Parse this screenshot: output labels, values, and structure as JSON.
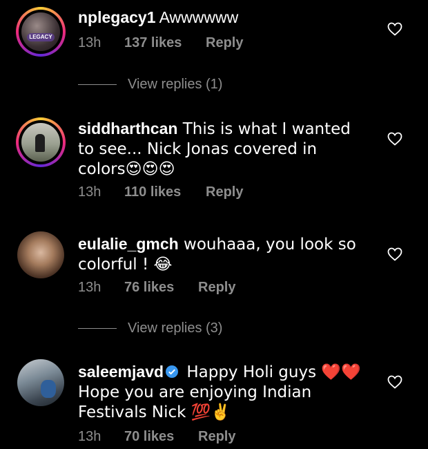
{
  "comments": [
    {
      "username": "nplegacy1",
      "text": " Awwwwww",
      "time": "13h",
      "likes": "137 likes",
      "reply": "Reply",
      "view_replies": "View replies (1)",
      "avatar_badge": "LEGACY"
    },
    {
      "username": "siddharthcan",
      "text": " This is what I wanted to see... Nick Jonas covered in colors😍😍😍",
      "time": "13h",
      "likes": "110 likes",
      "reply": "Reply"
    },
    {
      "username": "eulalie_gmch",
      "text": " wouhaaa, you look so colorful ! 😂",
      "time": "13h",
      "likes": "76 likes",
      "reply": "Reply",
      "view_replies": "View replies (3)"
    },
    {
      "username": "saleemjavd",
      "text": " Happy Holi guys ❤️❤️ Hope you are enjoying Indian Festivals Nick 💯✌️",
      "time": "13h",
      "likes": "70 likes",
      "reply": "Reply"
    }
  ],
  "icons": {
    "like": "heart-outline-icon",
    "verified": "verified-badge-icon"
  },
  "colors": {
    "background": "#000000",
    "text": "#ffffff",
    "muted": "#8e8e8e",
    "verified": "#3897f0"
  }
}
